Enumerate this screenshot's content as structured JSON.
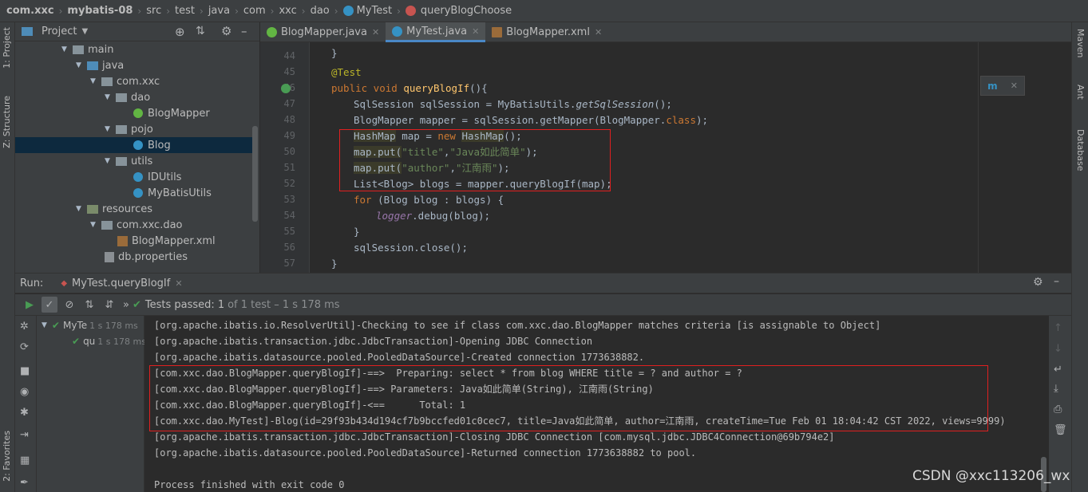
{
  "breadcrumb": {
    "items": [
      "com.xxc",
      "mybatis-08",
      "src",
      "test",
      "java",
      "com",
      "xxc",
      "dao",
      "MyTest",
      "queryBlogChoose"
    ]
  },
  "left_strip": {
    "project": "1: Project",
    "structure": "Z: Structure",
    "favorites": "2: Favorites"
  },
  "right_strip": {
    "maven": "Maven",
    "ant": "Ant",
    "database": "Database"
  },
  "project_panel": {
    "title": "Project",
    "tree": [
      {
        "label": "main",
        "kind": "folder",
        "expanded": true
      },
      {
        "label": "java",
        "kind": "folder-blue",
        "expanded": true
      },
      {
        "label": "com.xxc",
        "kind": "folder",
        "expanded": true
      },
      {
        "label": "dao",
        "kind": "folder",
        "expanded": true
      },
      {
        "label": "BlogMapper",
        "kind": "interface"
      },
      {
        "label": "pojo",
        "kind": "folder",
        "expanded": true
      },
      {
        "label": "Blog",
        "kind": "class",
        "selected": true
      },
      {
        "label": "utils",
        "kind": "folder",
        "expanded": true
      },
      {
        "label": "IDUtils",
        "kind": "class"
      },
      {
        "label": "MyBatisUtils",
        "kind": "class"
      },
      {
        "label": "resources",
        "kind": "folder-res",
        "expanded": true
      },
      {
        "label": "com.xxc.dao",
        "kind": "folder",
        "expanded": true
      },
      {
        "label": "BlogMapper.xml",
        "kind": "xml"
      },
      {
        "label": "db.properties",
        "kind": "props"
      }
    ]
  },
  "editor": {
    "tabs": [
      {
        "label": "BlogMapper.java",
        "active": false,
        "icon_color": "#62b543"
      },
      {
        "label": "MyTest.java",
        "active": true,
        "icon_color": "#3592c4"
      },
      {
        "label": "BlogMapper.xml",
        "active": false,
        "icon_color": "#9a6b3a"
      }
    ],
    "line_numbers": [
      "44",
      "45",
      "46",
      "47",
      "48",
      "49",
      "50",
      "51",
      "52",
      "53",
      "54",
      "55",
      "56",
      "57"
    ],
    "code": {
      "l44": "}",
      "l45_ann": "@Test",
      "l46_kw": "public void ",
      "l46_fn": "queryBlogIf",
      "l46_rest": "(){",
      "l47_a": "SqlSession sqlSession = MyBatisUtils.",
      "l47_b": "getSqlSession",
      "l47_c": "();",
      "l48_a": "BlogMapper mapper = sqlSession.getMapper(BlogMapper.",
      "l48_kw": "class",
      "l48_c": ");",
      "l49_a": "HashMap",
      "l49_b": " map = ",
      "l49_kw": "new ",
      "l49_c": "HashMap",
      "l49_d": "();",
      "l50_a": "map.put(",
      "l50_s1": "\"title\"",
      "l50_b": ",",
      "l50_s2": "\"Java如此简单\"",
      "l50_c": ");",
      "l51_a": "map.put(",
      "l51_s1": "\"author\"",
      "l51_b": ",",
      "l51_s2": "\"江南雨\"",
      "l51_c": ");",
      "l52": "List<Blog> blogs = mapper.queryBlogIf(map);",
      "l53_kw": "for ",
      "l53_rest": "(Blog blog : blogs) {",
      "l54_a": "logger",
      "l54_b": ".debug(blog);",
      "l55": "}",
      "l56": "sqlSession.close();",
      "l57": "}"
    }
  },
  "run_panel": {
    "label": "Run:",
    "tab": "MyTest.queryBlogIf",
    "status_prefix": "Tests passed:",
    "status_count": "1",
    "status_suffix": "of 1 test – 1 s 178 ms",
    "tree": [
      {
        "label": "MyTe",
        "duration": "1 s 178 ms"
      },
      {
        "label": "qu",
        "duration": "1 s 178 ms"
      }
    ],
    "console": [
      "[org.apache.ibatis.io.ResolverUtil]-Checking to see if class com.xxc.dao.BlogMapper matches criteria [is assignable to Object]",
      "[org.apache.ibatis.transaction.jdbc.JdbcTransaction]-Opening JDBC Connection",
      "[org.apache.ibatis.datasource.pooled.PooledDataSource]-Created connection 1773638882.",
      "[com.xxc.dao.BlogMapper.queryBlogIf]-==>  Preparing: select * from blog WHERE title = ? and author = ?",
      "[com.xxc.dao.BlogMapper.queryBlogIf]-==> Parameters: Java如此简单(String), 江南雨(String)",
      "[com.xxc.dao.BlogMapper.queryBlogIf]-<==      Total: 1",
      "[com.xxc.dao.MyTest]-Blog(id=29f93b434d194cf7b9bccfed01c0cec7, title=Java如此简单, author=江南雨, createTime=Tue Feb 01 18:04:42 CST 2022, views=9999)",
      "[org.apache.ibatis.transaction.jdbc.JdbcTransaction]-Closing JDBC Connection [com.mysql.jdbc.JDBC4Connection@69b794e2]",
      "[org.apache.ibatis.datasource.pooled.PooledDataSource]-Returned connection 1773638882 to pool.",
      "",
      "Process finished with exit code 0"
    ]
  },
  "watermark": "CSDN @xxc113206_wx"
}
